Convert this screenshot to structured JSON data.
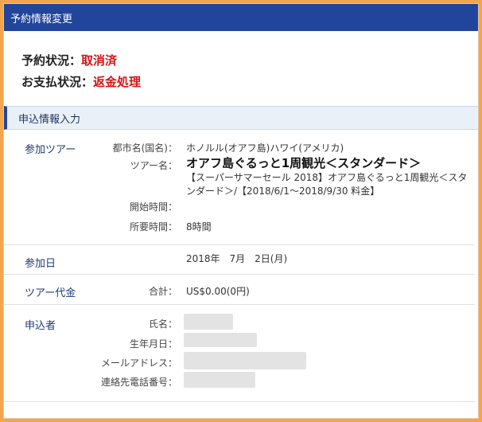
{
  "window": {
    "title": "予約情報変更"
  },
  "status": {
    "booking_label": "予約状況：",
    "booking_value": "取消済",
    "payment_label": "お支払状況：",
    "payment_value": "返金処理"
  },
  "section": {
    "title": "申込情報入力"
  },
  "tour": {
    "section_label": "参加ツアー",
    "city_label": "都市名(国名)：",
    "city_value": "ホノルル(オアフ島)ハワイ(アメリカ)",
    "name_label": "ツアー名：",
    "name_value": "オアフ島ぐるっと1周観光＜スタンダード＞",
    "name_detail": "【スーパーサマーセール 2018】オアフ島ぐるっと1周観光＜スタンダード＞/【2018/6/1〜2018/9/30 料金】",
    "start_label": "開始時間：",
    "start_value": "",
    "duration_label": "所要時間：",
    "duration_value": "8時間"
  },
  "date": {
    "section_label": "参加日",
    "value": "2018年　7月　2日(月)"
  },
  "price": {
    "section_label": "ツアー代金",
    "total_label": "合計：",
    "total_value": "US$0.00(0円)"
  },
  "applicant": {
    "section_label": "申込者",
    "name_label": "氏名：",
    "birth_label": "生年月日：",
    "email_label": "メールアドレス：",
    "phone_label": "連絡先電話番号："
  },
  "colors": {
    "accent": "#20459a",
    "alert": "#d41515",
    "frame": "#f1a54f"
  }
}
